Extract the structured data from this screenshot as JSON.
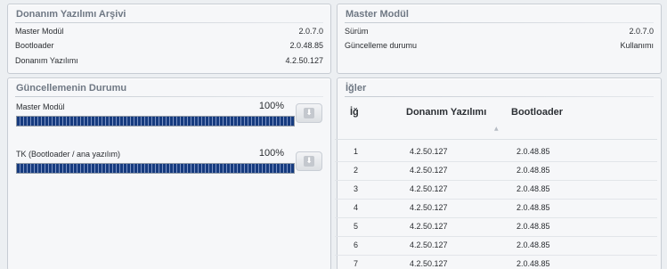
{
  "firmware_archive": {
    "title": "Donanım Yazılımı Arşivi",
    "rows": [
      {
        "label": "Master Modül",
        "value": "2.0.7.0"
      },
      {
        "label": "Bootloader",
        "value": "2.0.48.85"
      },
      {
        "label": "Donanım Yazılımı",
        "value": "4.2.50.127"
      }
    ]
  },
  "master_module": {
    "title": "Master Modül",
    "rows": [
      {
        "label": "Sürüm",
        "value": "2.0.7.0"
      },
      {
        "label": "Güncelleme durumu",
        "value": "Kullanımı"
      }
    ]
  },
  "update_status": {
    "title": "Güncellemenin Durumu",
    "items": [
      {
        "label": "Master Modül",
        "percent_text": "100%",
        "progress": 1.0,
        "button_icon": "download-icon"
      },
      {
        "label": "TK (Bootloader / ana yazılım)",
        "percent_text": "100%",
        "progress": 1.0,
        "button_icon": "download-icon"
      }
    ]
  },
  "nodes": {
    "title": "İğler",
    "columns": [
      "İğ",
      "Donanım Yazılımı",
      "Bootloader"
    ],
    "sort_icon": "sort-up-icon",
    "rows": [
      {
        "id": "1",
        "firmware": "4.2.50.127",
        "bootloader": "2.0.48.85"
      },
      {
        "id": "2",
        "firmware": "4.2.50.127",
        "bootloader": "2.0.48.85"
      },
      {
        "id": "3",
        "firmware": "4.2.50.127",
        "bootloader": "2.0.48.85"
      },
      {
        "id": "4",
        "firmware": "4.2.50.127",
        "bootloader": "2.0.48.85"
      },
      {
        "id": "5",
        "firmware": "4.2.50.127",
        "bootloader": "2.0.48.85"
      },
      {
        "id": "6",
        "firmware": "4.2.50.127",
        "bootloader": "2.0.48.85"
      },
      {
        "id": "7",
        "firmware": "4.2.50.127",
        "bootloader": "2.0.48.85"
      }
    ]
  },
  "colors": {
    "progress_fill": "#163b7f",
    "panel_background": "#f6f7f9",
    "title_text": "#6f7884"
  }
}
